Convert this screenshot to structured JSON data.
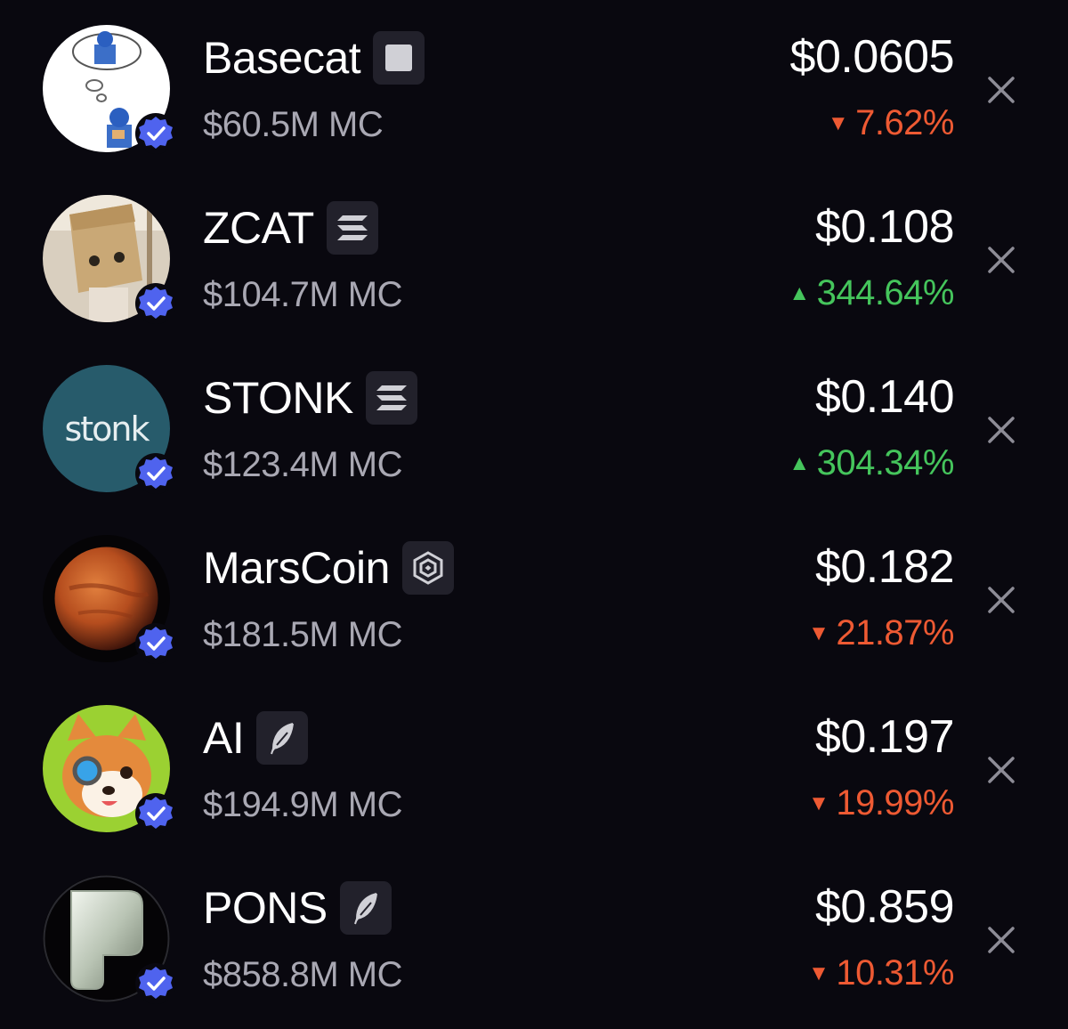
{
  "tokens": [
    {
      "name": "Basecat",
      "chain_icon": "base-icon",
      "mcap": "$60.5M MC",
      "price": "$0.0605",
      "change": "7.62%",
      "direction": "down",
      "arrow": "▼",
      "verified": true
    },
    {
      "name": "ZCAT",
      "chain_icon": "solana-icon",
      "mcap": "$104.7M MC",
      "price": "$0.108",
      "change": "344.64%",
      "direction": "up",
      "arrow": "▲",
      "verified": true
    },
    {
      "name": "STONK",
      "chain_icon": "solana-icon",
      "mcap": "$123.4M MC",
      "price": "$0.140",
      "change": "304.34%",
      "direction": "up",
      "arrow": "▲",
      "verified": true,
      "avatar_text": "stonk"
    },
    {
      "name": "MarsCoin",
      "chain_icon": "bnb-icon",
      "mcap": "$181.5M MC",
      "price": "$0.182",
      "change": "21.87%",
      "direction": "down",
      "arrow": "▼",
      "verified": true
    },
    {
      "name": "AI",
      "chain_icon": "feather-icon",
      "mcap": "$194.9M MC",
      "price": "$0.197",
      "change": "19.99%",
      "direction": "down",
      "arrow": "▼",
      "verified": true
    },
    {
      "name": "PONS",
      "chain_icon": "feather-icon",
      "mcap": "$858.8M MC",
      "price": "$0.859",
      "change": "10.31%",
      "direction": "down",
      "arrow": "▼",
      "verified": true
    }
  ],
  "colors": {
    "background": "#09080f",
    "up": "#45c55c",
    "down": "#ee5a33",
    "verified": "#4f63ee",
    "muted_text": "#a9a8b3"
  }
}
